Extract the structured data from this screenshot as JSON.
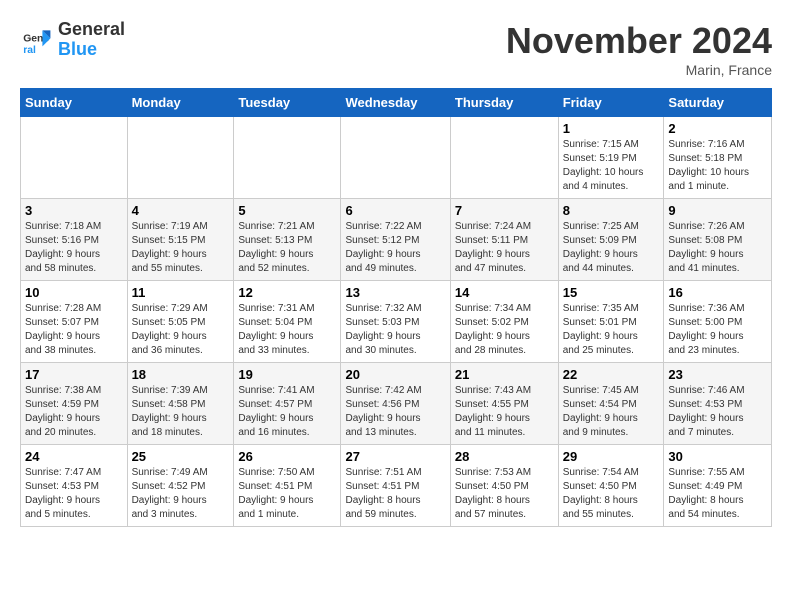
{
  "logo": {
    "line1": "General",
    "line2": "Blue"
  },
  "header": {
    "month": "November 2024",
    "location": "Marin, France"
  },
  "weekdays": [
    "Sunday",
    "Monday",
    "Tuesday",
    "Wednesday",
    "Thursday",
    "Friday",
    "Saturday"
  ],
  "weeks": [
    [
      {
        "day": "",
        "info": ""
      },
      {
        "day": "",
        "info": ""
      },
      {
        "day": "",
        "info": ""
      },
      {
        "day": "",
        "info": ""
      },
      {
        "day": "",
        "info": ""
      },
      {
        "day": "1",
        "info": "Sunrise: 7:15 AM\nSunset: 5:19 PM\nDaylight: 10 hours\nand 4 minutes."
      },
      {
        "day": "2",
        "info": "Sunrise: 7:16 AM\nSunset: 5:18 PM\nDaylight: 10 hours\nand 1 minute."
      }
    ],
    [
      {
        "day": "3",
        "info": "Sunrise: 7:18 AM\nSunset: 5:16 PM\nDaylight: 9 hours\nand 58 minutes."
      },
      {
        "day": "4",
        "info": "Sunrise: 7:19 AM\nSunset: 5:15 PM\nDaylight: 9 hours\nand 55 minutes."
      },
      {
        "day": "5",
        "info": "Sunrise: 7:21 AM\nSunset: 5:13 PM\nDaylight: 9 hours\nand 52 minutes."
      },
      {
        "day": "6",
        "info": "Sunrise: 7:22 AM\nSunset: 5:12 PM\nDaylight: 9 hours\nand 49 minutes."
      },
      {
        "day": "7",
        "info": "Sunrise: 7:24 AM\nSunset: 5:11 PM\nDaylight: 9 hours\nand 47 minutes."
      },
      {
        "day": "8",
        "info": "Sunrise: 7:25 AM\nSunset: 5:09 PM\nDaylight: 9 hours\nand 44 minutes."
      },
      {
        "day": "9",
        "info": "Sunrise: 7:26 AM\nSunset: 5:08 PM\nDaylight: 9 hours\nand 41 minutes."
      }
    ],
    [
      {
        "day": "10",
        "info": "Sunrise: 7:28 AM\nSunset: 5:07 PM\nDaylight: 9 hours\nand 38 minutes."
      },
      {
        "day": "11",
        "info": "Sunrise: 7:29 AM\nSunset: 5:05 PM\nDaylight: 9 hours\nand 36 minutes."
      },
      {
        "day": "12",
        "info": "Sunrise: 7:31 AM\nSunset: 5:04 PM\nDaylight: 9 hours\nand 33 minutes."
      },
      {
        "day": "13",
        "info": "Sunrise: 7:32 AM\nSunset: 5:03 PM\nDaylight: 9 hours\nand 30 minutes."
      },
      {
        "day": "14",
        "info": "Sunrise: 7:34 AM\nSunset: 5:02 PM\nDaylight: 9 hours\nand 28 minutes."
      },
      {
        "day": "15",
        "info": "Sunrise: 7:35 AM\nSunset: 5:01 PM\nDaylight: 9 hours\nand 25 minutes."
      },
      {
        "day": "16",
        "info": "Sunrise: 7:36 AM\nSunset: 5:00 PM\nDaylight: 9 hours\nand 23 minutes."
      }
    ],
    [
      {
        "day": "17",
        "info": "Sunrise: 7:38 AM\nSunset: 4:59 PM\nDaylight: 9 hours\nand 20 minutes."
      },
      {
        "day": "18",
        "info": "Sunrise: 7:39 AM\nSunset: 4:58 PM\nDaylight: 9 hours\nand 18 minutes."
      },
      {
        "day": "19",
        "info": "Sunrise: 7:41 AM\nSunset: 4:57 PM\nDaylight: 9 hours\nand 16 minutes."
      },
      {
        "day": "20",
        "info": "Sunrise: 7:42 AM\nSunset: 4:56 PM\nDaylight: 9 hours\nand 13 minutes."
      },
      {
        "day": "21",
        "info": "Sunrise: 7:43 AM\nSunset: 4:55 PM\nDaylight: 9 hours\nand 11 minutes."
      },
      {
        "day": "22",
        "info": "Sunrise: 7:45 AM\nSunset: 4:54 PM\nDaylight: 9 hours\nand 9 minutes."
      },
      {
        "day": "23",
        "info": "Sunrise: 7:46 AM\nSunset: 4:53 PM\nDaylight: 9 hours\nand 7 minutes."
      }
    ],
    [
      {
        "day": "24",
        "info": "Sunrise: 7:47 AM\nSunset: 4:53 PM\nDaylight: 9 hours\nand 5 minutes."
      },
      {
        "day": "25",
        "info": "Sunrise: 7:49 AM\nSunset: 4:52 PM\nDaylight: 9 hours\nand 3 minutes."
      },
      {
        "day": "26",
        "info": "Sunrise: 7:50 AM\nSunset: 4:51 PM\nDaylight: 9 hours\nand 1 minute."
      },
      {
        "day": "27",
        "info": "Sunrise: 7:51 AM\nSunset: 4:51 PM\nDaylight: 8 hours\nand 59 minutes."
      },
      {
        "day": "28",
        "info": "Sunrise: 7:53 AM\nSunset: 4:50 PM\nDaylight: 8 hours\nand 57 minutes."
      },
      {
        "day": "29",
        "info": "Sunrise: 7:54 AM\nSunset: 4:50 PM\nDaylight: 8 hours\nand 55 minutes."
      },
      {
        "day": "30",
        "info": "Sunrise: 7:55 AM\nSunset: 4:49 PM\nDaylight: 8 hours\nand 54 minutes."
      }
    ]
  ]
}
